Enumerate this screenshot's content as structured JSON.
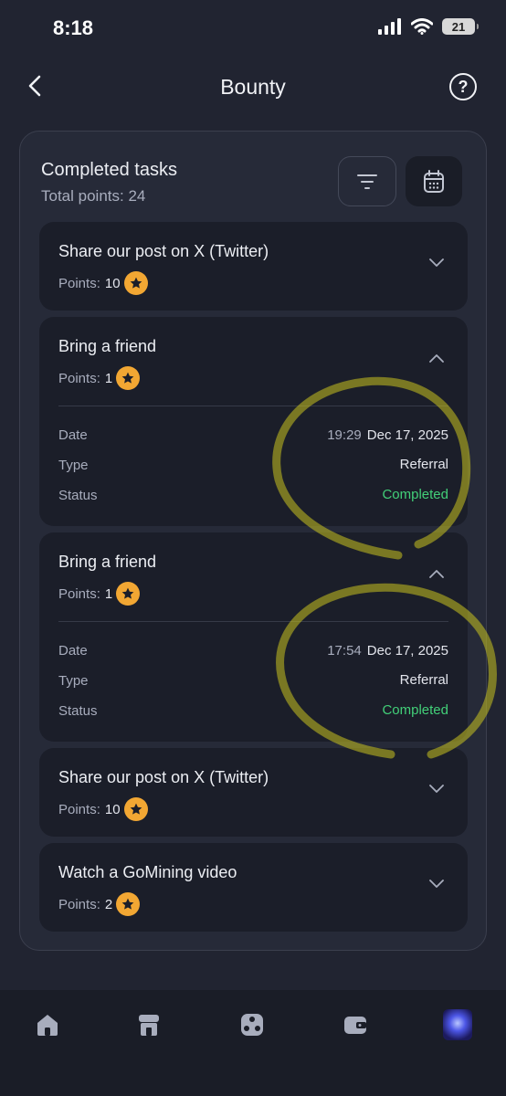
{
  "status_bar": {
    "time": "8:18",
    "battery": "21"
  },
  "header": {
    "title": "Bounty",
    "help_icon": "question-circle-icon"
  },
  "panel": {
    "title": "Completed tasks",
    "total_points": "Total points: 24"
  },
  "labels": {
    "points": "Points:",
    "date": "Date",
    "type": "Type",
    "status": "Status"
  },
  "tasks": [
    {
      "title": "Share our post on X (Twitter)",
      "points": "10",
      "expanded": false
    },
    {
      "title": "Bring a friend",
      "points": "1",
      "expanded": true,
      "time": "19:29",
      "date": "Dec 17, 2025",
      "type": "Referral",
      "status": "Completed"
    },
    {
      "title": "Bring a friend",
      "points": "1",
      "expanded": true,
      "time": "17:54",
      "date": "Dec 17, 2025",
      "type": "Referral",
      "status": "Completed"
    },
    {
      "title": "Share our post on X (Twitter)",
      "points": "10",
      "expanded": false
    },
    {
      "title": "Watch a GoMining video",
      "points": "2",
      "expanded": false
    }
  ],
  "tabbar": {
    "items": [
      "home-icon",
      "shop-icon",
      "games-icon",
      "wallet-icon",
      "profile-avatar"
    ]
  },
  "colors": {
    "background": "#212431",
    "card": "#1b1e29",
    "star": "#f2a733",
    "completed": "#42cf78"
  }
}
